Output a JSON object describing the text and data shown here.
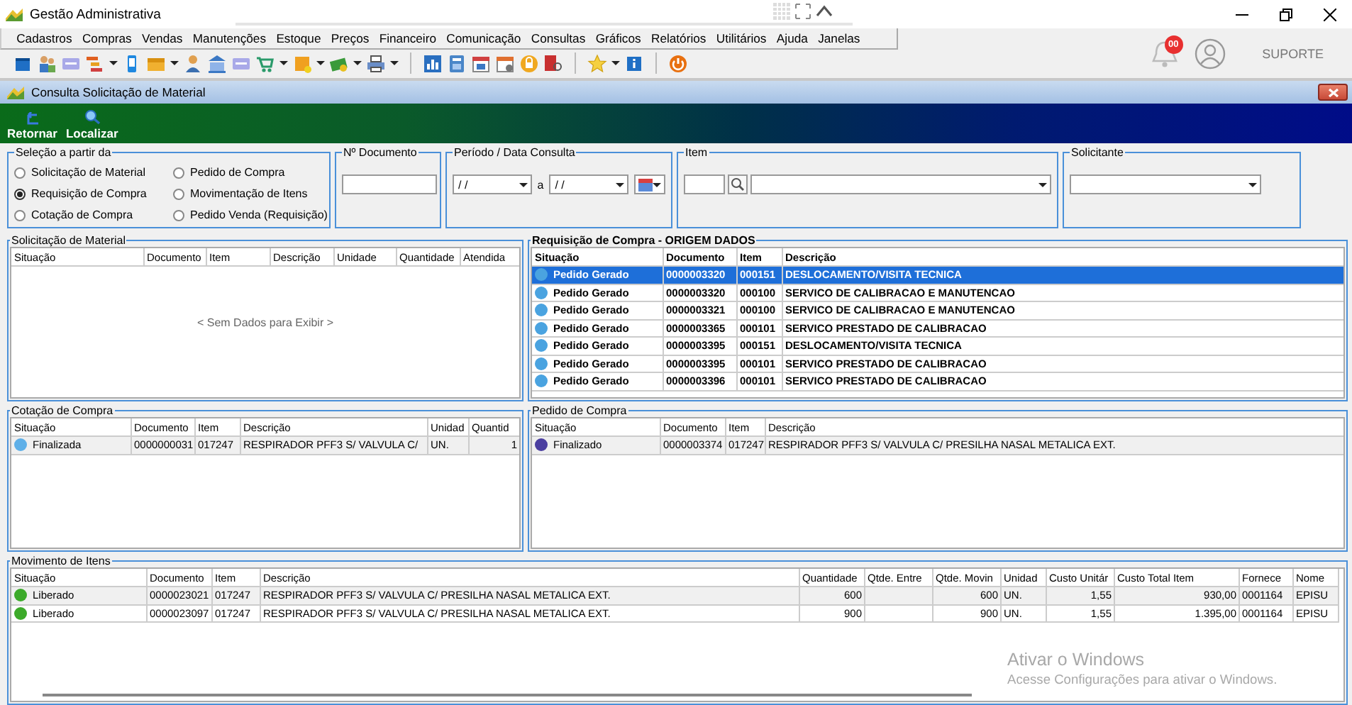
{
  "window": {
    "title": "Gestão Administrativa"
  },
  "menu": [
    {
      "label": "Cadastros"
    },
    {
      "label": "Compras"
    },
    {
      "label": "Vendas"
    },
    {
      "label": "Manutenções"
    },
    {
      "label": "Estoque"
    },
    {
      "label": "Preços"
    },
    {
      "label": "Financeiro"
    },
    {
      "label": "Comunicação"
    },
    {
      "label": "Consultas"
    },
    {
      "label": "Gráficos"
    },
    {
      "label": "Relatórios"
    },
    {
      "label": "Utilitários"
    },
    {
      "label": "Ajuda"
    },
    {
      "label": "Janelas"
    }
  ],
  "user": {
    "notifications": "00",
    "name": "SUPORTE"
  },
  "child_window": {
    "title": "Consulta Solicitação de Material"
  },
  "actions": [
    {
      "label": "Retornar",
      "kind": "back"
    },
    {
      "label": "Localizar",
      "kind": "search"
    }
  ],
  "selection": {
    "title": "Seleção a partir da",
    "options": [
      {
        "label": "Solicitação de Material",
        "selected": false
      },
      {
        "label": "Requisição de Compra",
        "selected": true
      },
      {
        "label": "Cotação de Compra",
        "selected": false
      },
      {
        "label": "Pedido de Compra",
        "selected": false
      },
      {
        "label": "Movimentação de Itens",
        "selected": false
      },
      {
        "label": "Pedido Venda (Requisição)",
        "selected": false
      }
    ]
  },
  "document": {
    "title": "Nº Documento"
  },
  "period": {
    "title": "Período / Data Consulta",
    "from": "/ /",
    "separator": "a",
    "to": "/ /"
  },
  "item": {
    "title": "Item"
  },
  "requester": {
    "title": "Solicitante"
  },
  "panels": [
    {
      "title": "Solicitação de Material",
      "columns": [
        "Situação",
        "Documento",
        "Item",
        "Descrição",
        "Unidade",
        "Quantidade",
        "Atendida"
      ],
      "empty_text": "< Sem Dados para Exibir >"
    },
    {
      "title": "Requisição de Compra - ORIGEM DADOS",
      "columns": [
        "Situação",
        "Documento",
        "Item",
        "Descrição"
      ],
      "rows": [
        {
          "selected": true,
          "color": "#4aa3e0",
          "cells": [
            "Pedido Gerado",
            "0000003320",
            "000151",
            "DESLOCAMENTO/VISITA TECNICA"
          ]
        },
        {
          "selected": false,
          "color": "#4aa3e0",
          "cells": [
            "Pedido Gerado",
            "0000003320",
            "000100",
            "SERVICO DE CALIBRACAO E MANUTENCAO"
          ]
        },
        {
          "selected": false,
          "color": "#4aa3e0",
          "cells": [
            "Pedido Gerado",
            "0000003321",
            "000100",
            "SERVICO DE CALIBRACAO E MANUTENCAO"
          ]
        },
        {
          "selected": false,
          "color": "#4aa3e0",
          "cells": [
            "Pedido Gerado",
            "0000003365",
            "000101",
            "SERVICO PRESTADO DE CALIBRACAO"
          ]
        },
        {
          "selected": false,
          "color": "#4aa3e0",
          "cells": [
            "Pedido Gerado",
            "0000003395",
            "000151",
            "DESLOCAMENTO/VISITA TECNICA"
          ]
        },
        {
          "selected": false,
          "color": "#4aa3e0",
          "cells": [
            "Pedido Gerado",
            "0000003395",
            "000101",
            "SERVICO PRESTADO DE CALIBRACAO"
          ]
        },
        {
          "selected": false,
          "color": "#4aa3e0",
          "cells": [
            "Pedido Gerado",
            "0000003396",
            "000101",
            "SERVICO PRESTADO DE CALIBRACAO"
          ]
        }
      ]
    },
    {
      "title": "Cotação de Compra",
      "columns": [
        "Situação",
        "Documento",
        "Item",
        "Descrição",
        "Unidad",
        "Quantid"
      ],
      "rows": [
        {
          "selected": true,
          "color": "#5fb0e8",
          "cells": [
            "Finalizada",
            "0000000031",
            "017247",
            "RESPIRADOR PFF3 S/ VALVULA C/",
            "UN.",
            "1"
          ]
        }
      ]
    },
    {
      "title": "Pedido de Compra",
      "columns": [
        "Situação",
        "Documento",
        "Item",
        "Descrição"
      ],
      "rows": [
        {
          "selected": true,
          "color": "#4b3fa0",
          "cells": [
            "Finalizado",
            "0000003374",
            "017247",
            "RESPIRADOR PFF3 S/ VALVULA C/  PRESILHA NASAL METALICA EXT."
          ]
        }
      ]
    },
    {
      "title": "Movimento de Itens",
      "columns": [
        "Situação",
        "Documento",
        "Item",
        "Descrição",
        "Quantidade",
        "Qtde. Entre",
        "Qtde. Movin",
        "Unidad",
        "Custo Unitár",
        "Custo Total Item",
        "Fornece",
        "Nome"
      ],
      "rows": [
        {
          "selected": true,
          "color": "#3caa2a",
          "cells": [
            "Liberado",
            "0000023021",
            "017247",
            "RESPIRADOR PFF3 S/ VALVULA C/  PRESILHA NASAL METALICA EXT.",
            "600",
            null,
            "600",
            "UN.",
            "1,55",
            "930,00",
            "0001164",
            "EPISU"
          ]
        },
        {
          "selected": false,
          "color": "#3caa2a",
          "cells": [
            "Liberado",
            "0000023097",
            "017247",
            "RESPIRADOR PFF3 S/ VALVULA C/  PRESILHA NASAL METALICA EXT.",
            "900",
            null,
            "900",
            "UN.",
            "1,55",
            "1.395,00",
            "0001164",
            "EPISU"
          ]
        }
      ]
    }
  ],
  "activation_notice": {
    "title": "Ativar o Windows",
    "text": "Acesse Configurações para ativar o Windows."
  }
}
